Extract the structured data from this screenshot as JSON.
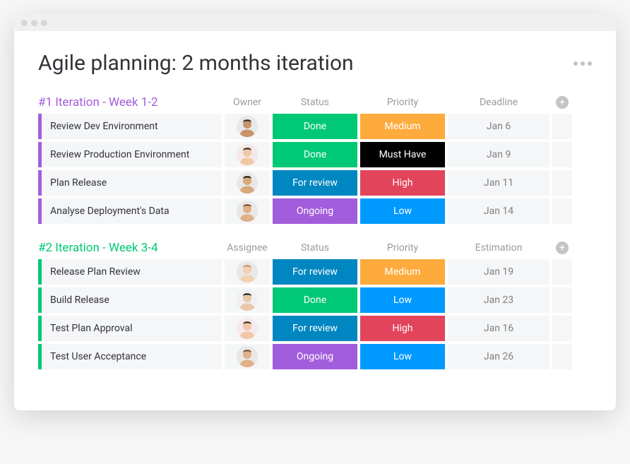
{
  "title": "Agile planning: 2 months iteration",
  "colors": {
    "done": "#00c875",
    "for_review": "#0086c0",
    "ongoing": "#a25ddc",
    "medium": "#fdab3d",
    "must_have": "#000000",
    "high": "#e2445c",
    "low": "#009aff"
  },
  "avatars": {
    "p1": {
      "skin": "#c8936a",
      "hair": "#2b2b2b",
      "bg": "#e8e8e8"
    },
    "p2": {
      "skin": "#f0c8a5",
      "hair": "#3a2a1a",
      "bg": "#f5e8e8"
    },
    "p3": {
      "skin": "#d9a878",
      "hair": "#201510",
      "bg": "#e8e8e8"
    },
    "p4": {
      "skin": "#e0b088",
      "hair": "#7a4a2a",
      "bg": "#e8e8e8"
    },
    "p5": {
      "skin": "#f2d0b0",
      "hair": "#c89060",
      "bg": "#e8e8e8"
    },
    "p6": {
      "skin": "#e8c8a8",
      "hair": "#1a1a1a",
      "bg": "#f0f0f0"
    },
    "p7": {
      "skin": "#f0c8a8",
      "hair": "#452a1a",
      "bg": "#f8e8f0"
    }
  },
  "groups": [
    {
      "id": "group-1",
      "title": "#1 Iteration - Week 1-2",
      "columns": [
        "Owner",
        "Status",
        "Priority",
        "Deadline"
      ],
      "rows": [
        {
          "task": "Review Dev Environment",
          "owner": "p1",
          "status": {
            "label": "Done",
            "color": "done"
          },
          "priority": {
            "label": "Medium",
            "color": "medium"
          },
          "date": "Jan 6"
        },
        {
          "task": "Review Production Environment",
          "owner": "p2",
          "status": {
            "label": "Done",
            "color": "done"
          },
          "priority": {
            "label": "Must Have",
            "color": "must_have"
          },
          "date": "Jan 9"
        },
        {
          "task": "Plan Release",
          "owner": "p3",
          "status": {
            "label": "For review",
            "color": "for_review"
          },
          "priority": {
            "label": "High",
            "color": "high"
          },
          "date": "Jan 11"
        },
        {
          "task": "Analyse Deployment's Data",
          "owner": "p4",
          "status": {
            "label": "Ongoing",
            "color": "ongoing"
          },
          "priority": {
            "label": "Low",
            "color": "low"
          },
          "date": "Jan 14"
        }
      ]
    },
    {
      "id": "group-2",
      "title": "#2 Iteration - Week 3-4",
      "columns": [
        "Assignee",
        "Status",
        "Priority",
        "Estimation"
      ],
      "rows": [
        {
          "task": "Release Plan Review",
          "owner": "p5",
          "status": {
            "label": "For review",
            "color": "for_review"
          },
          "priority": {
            "label": "Medium",
            "color": "medium"
          },
          "date": "Jan 19"
        },
        {
          "task": "Build Release",
          "owner": "p6",
          "status": {
            "label": "Done",
            "color": "done"
          },
          "priority": {
            "label": "Low",
            "color": "low"
          },
          "date": "Jan 23"
        },
        {
          "task": "Test Plan Approval",
          "owner": "p7",
          "status": {
            "label": "For review",
            "color": "for_review"
          },
          "priority": {
            "label": "High",
            "color": "high"
          },
          "date": "Jan 16"
        },
        {
          "task": "Test User Acceptance",
          "owner": "p4",
          "status": {
            "label": "Ongoing",
            "color": "ongoing"
          },
          "priority": {
            "label": "Low",
            "color": "low"
          },
          "date": "Jan 26"
        }
      ]
    }
  ]
}
